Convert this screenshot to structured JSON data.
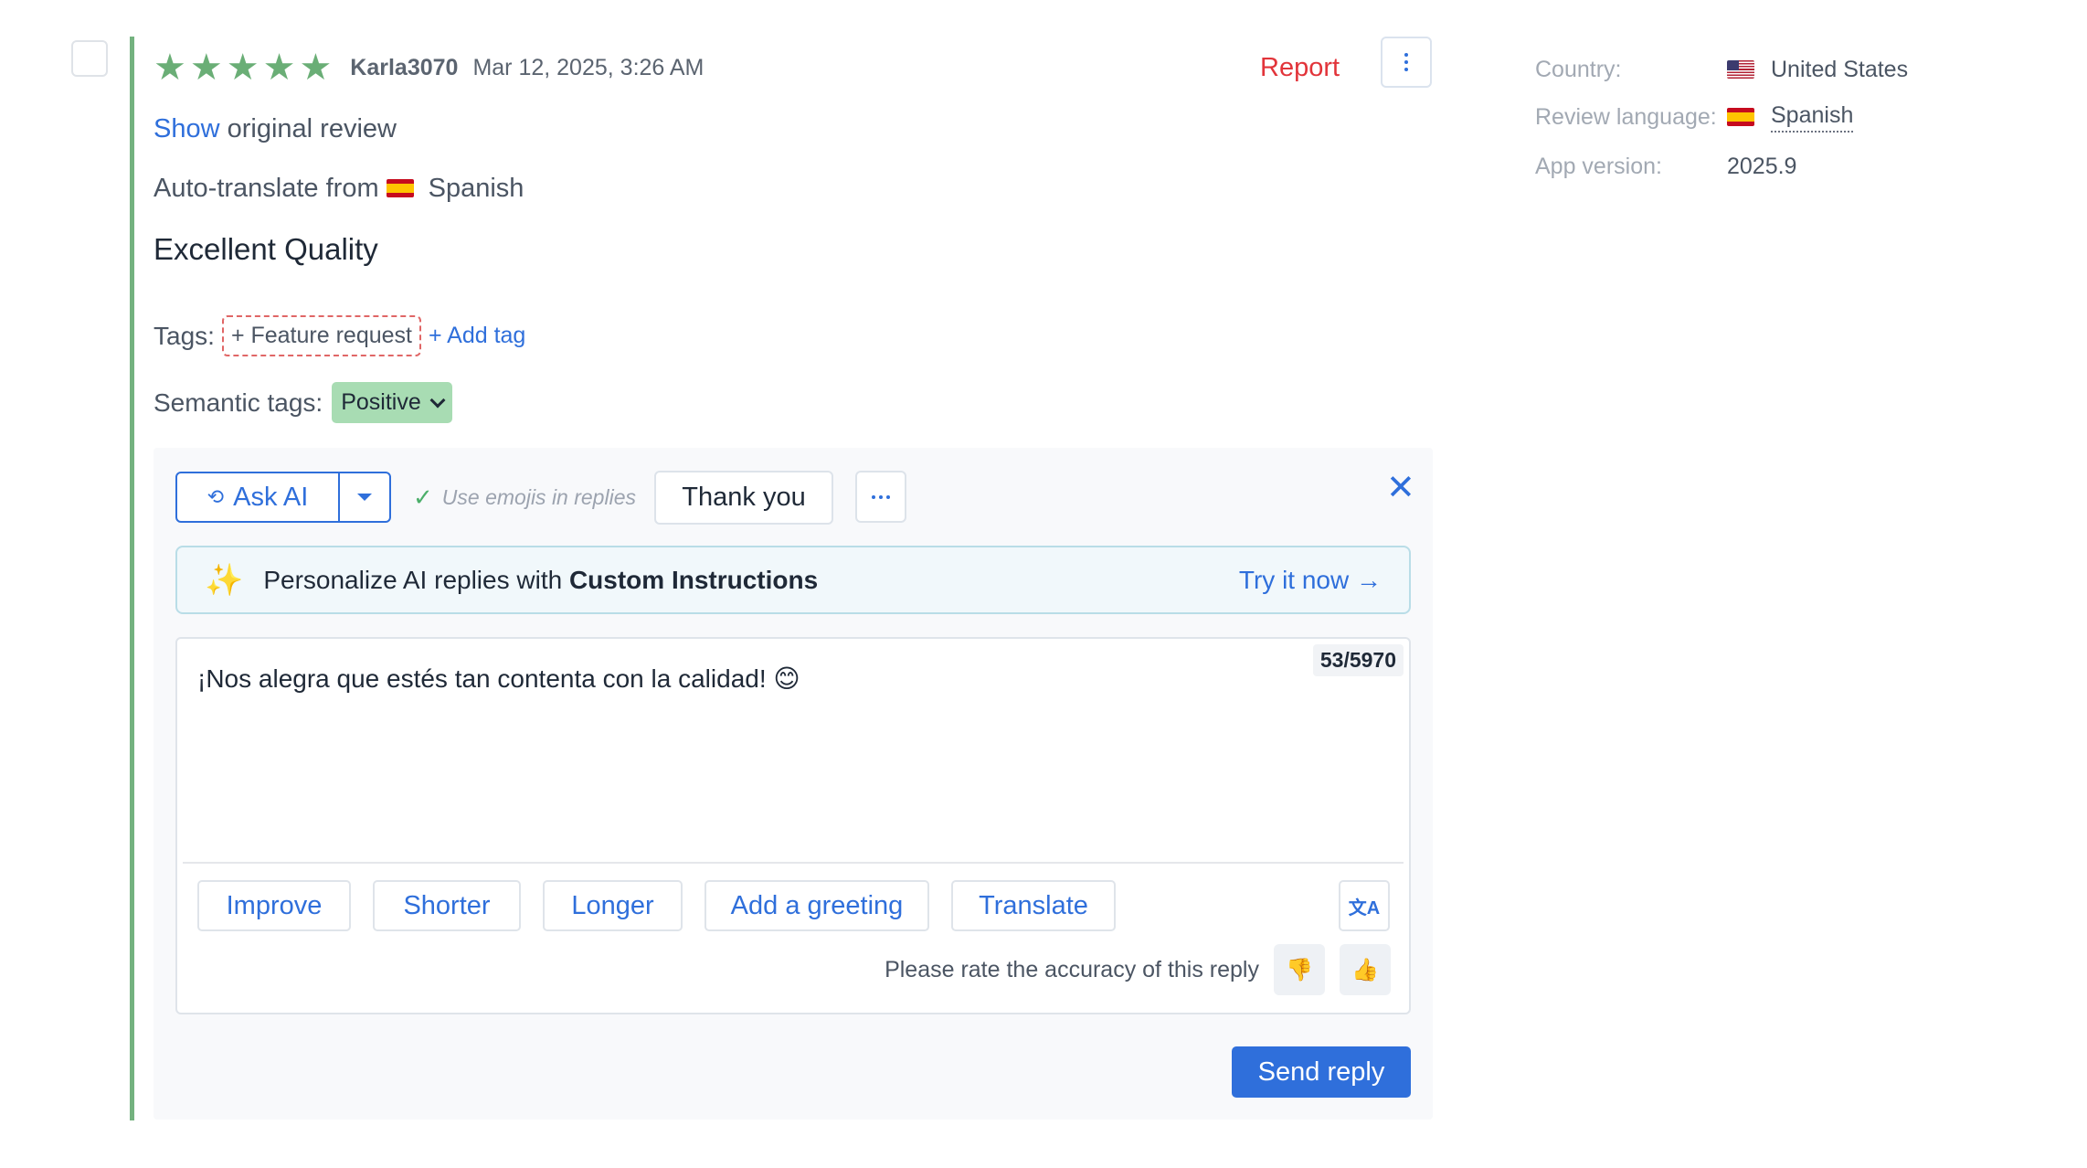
{
  "review": {
    "rating": 5,
    "author": "Karla3070",
    "date": "Mar 12, 2025, 3:26 AM",
    "report_label": "Report",
    "show_link": "Show",
    "show_rest": "original review",
    "auto_translate_label": "Auto-translate from",
    "source_language": "Spanish",
    "title": "Excellent Quality",
    "tags_label": "Tags:",
    "suggested_tag": "+ Feature request",
    "add_tag_label": "+ Add tag",
    "semantic_tags_label": "Semantic tags:",
    "semantic_tag": "Positive"
  },
  "reply": {
    "ask_ai_label": "Ask AI",
    "use_emojis_label": "Use emojis in replies",
    "thank_you_label": "Thank you",
    "promo_text": "Personalize AI replies with",
    "promo_bold": "Custom Instructions",
    "promo_link": "Try it now →",
    "counter": "53/5970",
    "text": "¡Nos alegra que estés tan contenta con la calidad! 😊",
    "actions": {
      "improve": "Improve",
      "shorter": "Shorter",
      "longer": "Longer",
      "greeting": "Add a greeting",
      "translate": "Translate"
    },
    "rate_label": "Please rate the accuracy of this reply",
    "send_label": "Send reply"
  },
  "info": {
    "country_label": "Country:",
    "country_value": "United States",
    "language_label": "Review language:",
    "language_value": "Spanish",
    "version_label": "App version:",
    "version_value": "2025.9"
  },
  "colors": {
    "accent_blue": "#2f6fdb",
    "star_green": "#6aae76",
    "report_red": "#e2343a",
    "positive_badge": "#a8dcb3"
  }
}
